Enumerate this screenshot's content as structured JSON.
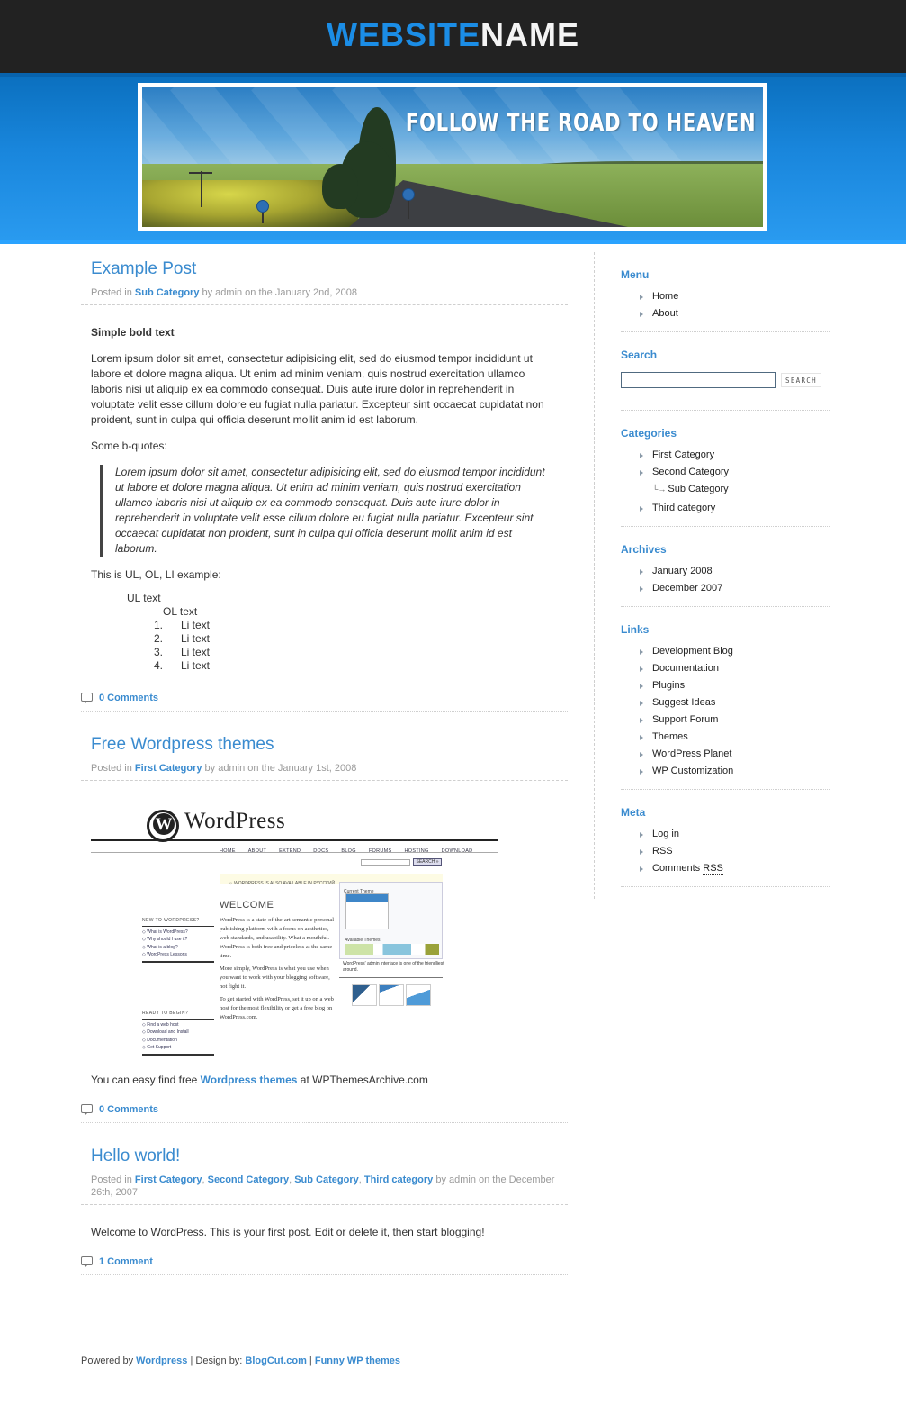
{
  "header": {
    "title_part1": "WEBSITE",
    "title_part2": "NAME",
    "banner_text": "FOLLOW THE ROAD TO HEAVEN"
  },
  "colors": {
    "accent": "#3a8bcf",
    "title_blue": "#1b8de6",
    "topbar": "#222222",
    "banner_band": "#1986dc"
  },
  "posts": [
    {
      "title": "Example Post",
      "meta_prefix": "Posted in ",
      "categories": [
        "Sub Category"
      ],
      "meta_suffix": " by admin on the January 2nd, 2008",
      "bold_text": "Simple bold text",
      "paragraph": "Lorem ipsum dolor sit amet, consectetur adipisicing elit, sed do eiusmod tempor incididunt ut labore et dolore magna aliqua. Ut enim ad minim veniam, quis nostrud exercitation ullamco laboris nisi ut aliquip ex ea commodo consequat. Duis aute irure dolor in reprehenderit in voluptate velit esse cillum dolore eu fugiat nulla pariatur. Excepteur sint occaecat cupidatat non proident, sunt in culpa qui officia deserunt mollit anim id est laborum.",
      "bquote_label": "Some b-quotes:",
      "blockquote": "Lorem ipsum dolor sit amet, consectetur adipisicing elit, sed do eiusmod tempor incididunt ut labore et dolore magna aliqua. Ut enim ad minim veniam, quis nostrud exercitation ullamco laboris nisi ut aliquip ex ea commodo consequat. Duis aute irure dolor in reprehenderit in voluptate velit esse cillum dolore eu fugiat nulla pariatur. Excepteur sint occaecat cupidatat non proident, sunt in culpa qui officia deserunt mollit anim id est laborum.",
      "list_label": "This is UL, OL, LI example:",
      "ul_text": "UL text",
      "ol_text": "OL text",
      "li_items": [
        "Li text",
        "Li text",
        "Li text",
        "Li text"
      ],
      "comments": "0 Comments"
    },
    {
      "title": "Free Wordpress themes",
      "meta_prefix": "Posted in ",
      "categories": [
        "First Category"
      ],
      "meta_suffix": " by admin on the January 1st, 2008",
      "screenshot": {
        "logo_text": "WordPress",
        "nav": [
          "HOME",
          "ABOUT",
          "EXTEND",
          "DOCS",
          "BLOG",
          "FORUMS",
          "HOSTING",
          "DOWNLOAD"
        ],
        "search_button": "SEARCH »",
        "notice": "☼ WORDPRESS IS ALSO AVAILABLE IN РУССКИЙ.",
        "welcome": "WELCOME",
        "paragraphs": [
          "WordPress is a state-of-the-art semantic personal publishing platform with a focus on aesthetics, web standards, and usability. What a mouthful. WordPress is both free and priceless at the same time.",
          "More simply, WordPress is what you use when you want to work with your blogging software, not fight it.",
          "To get started with WordPress, set it up on a web host for the most flexibility or get a free blog on WordPress.com."
        ],
        "side_new_heading": "NEW TO WORDPRESS?",
        "side_new_items": [
          "What is WordPress?",
          "Why should I use it?",
          "What is a blog?",
          "WordPress Lessons"
        ],
        "side_ready_heading": "READY TO BEGIN?",
        "side_ready_items": [
          "Find a web host",
          "Download and Install",
          "Documentation",
          "Get Support"
        ],
        "theme_box_title": "Current Theme",
        "available_themes": "Available Themes",
        "caption": "WordPress' admin interface is one of the friendliest around."
      },
      "body_prefix": "You can easy find free ",
      "body_link": "Wordpress themes",
      "body_suffix": " at WPThemesArchive.com",
      "comments": "0 Comments"
    },
    {
      "title": "Hello world!",
      "meta_prefix": "Posted in ",
      "categories": [
        "First Category",
        "Second Category",
        "Sub Category",
        "Third category"
      ],
      "meta_suffix": " by admin on the December 26th, 2007",
      "body": "Welcome to WordPress. This is your first post. Edit or delete it, then start blogging!",
      "comments": "1 Comment"
    }
  ],
  "sidebar": {
    "menu": {
      "title": "Menu",
      "items": [
        "Home",
        "About"
      ]
    },
    "search": {
      "title": "Search",
      "input_value": "",
      "placeholder": "",
      "button": "SEARCH"
    },
    "categories": {
      "title": "Categories",
      "items": [
        "First Category",
        "Second Category"
      ],
      "sub_item": "Sub Category",
      "sub_arrow": "└→",
      "last_item": "Third category"
    },
    "archives": {
      "title": "Archives",
      "items": [
        "January 2008",
        "December 2007"
      ]
    },
    "links": {
      "title": "Links",
      "items": [
        "Development Blog",
        "Documentation",
        "Plugins",
        "Suggest Ideas",
        "Support Forum",
        "Themes",
        "WordPress Planet",
        "WP Customization"
      ]
    },
    "meta": {
      "title": "Meta",
      "login": "Log in",
      "rss": "RSS",
      "comments_prefix": "Comments ",
      "comments_rss": "RSS"
    }
  },
  "footer": {
    "powered_prefix": "Powered by ",
    "powered_link": "Wordpress",
    "design_prefix": " | Design by: ",
    "design_link": "BlogCut.com",
    "sep": " | ",
    "funny_link": "Funny WP themes"
  }
}
